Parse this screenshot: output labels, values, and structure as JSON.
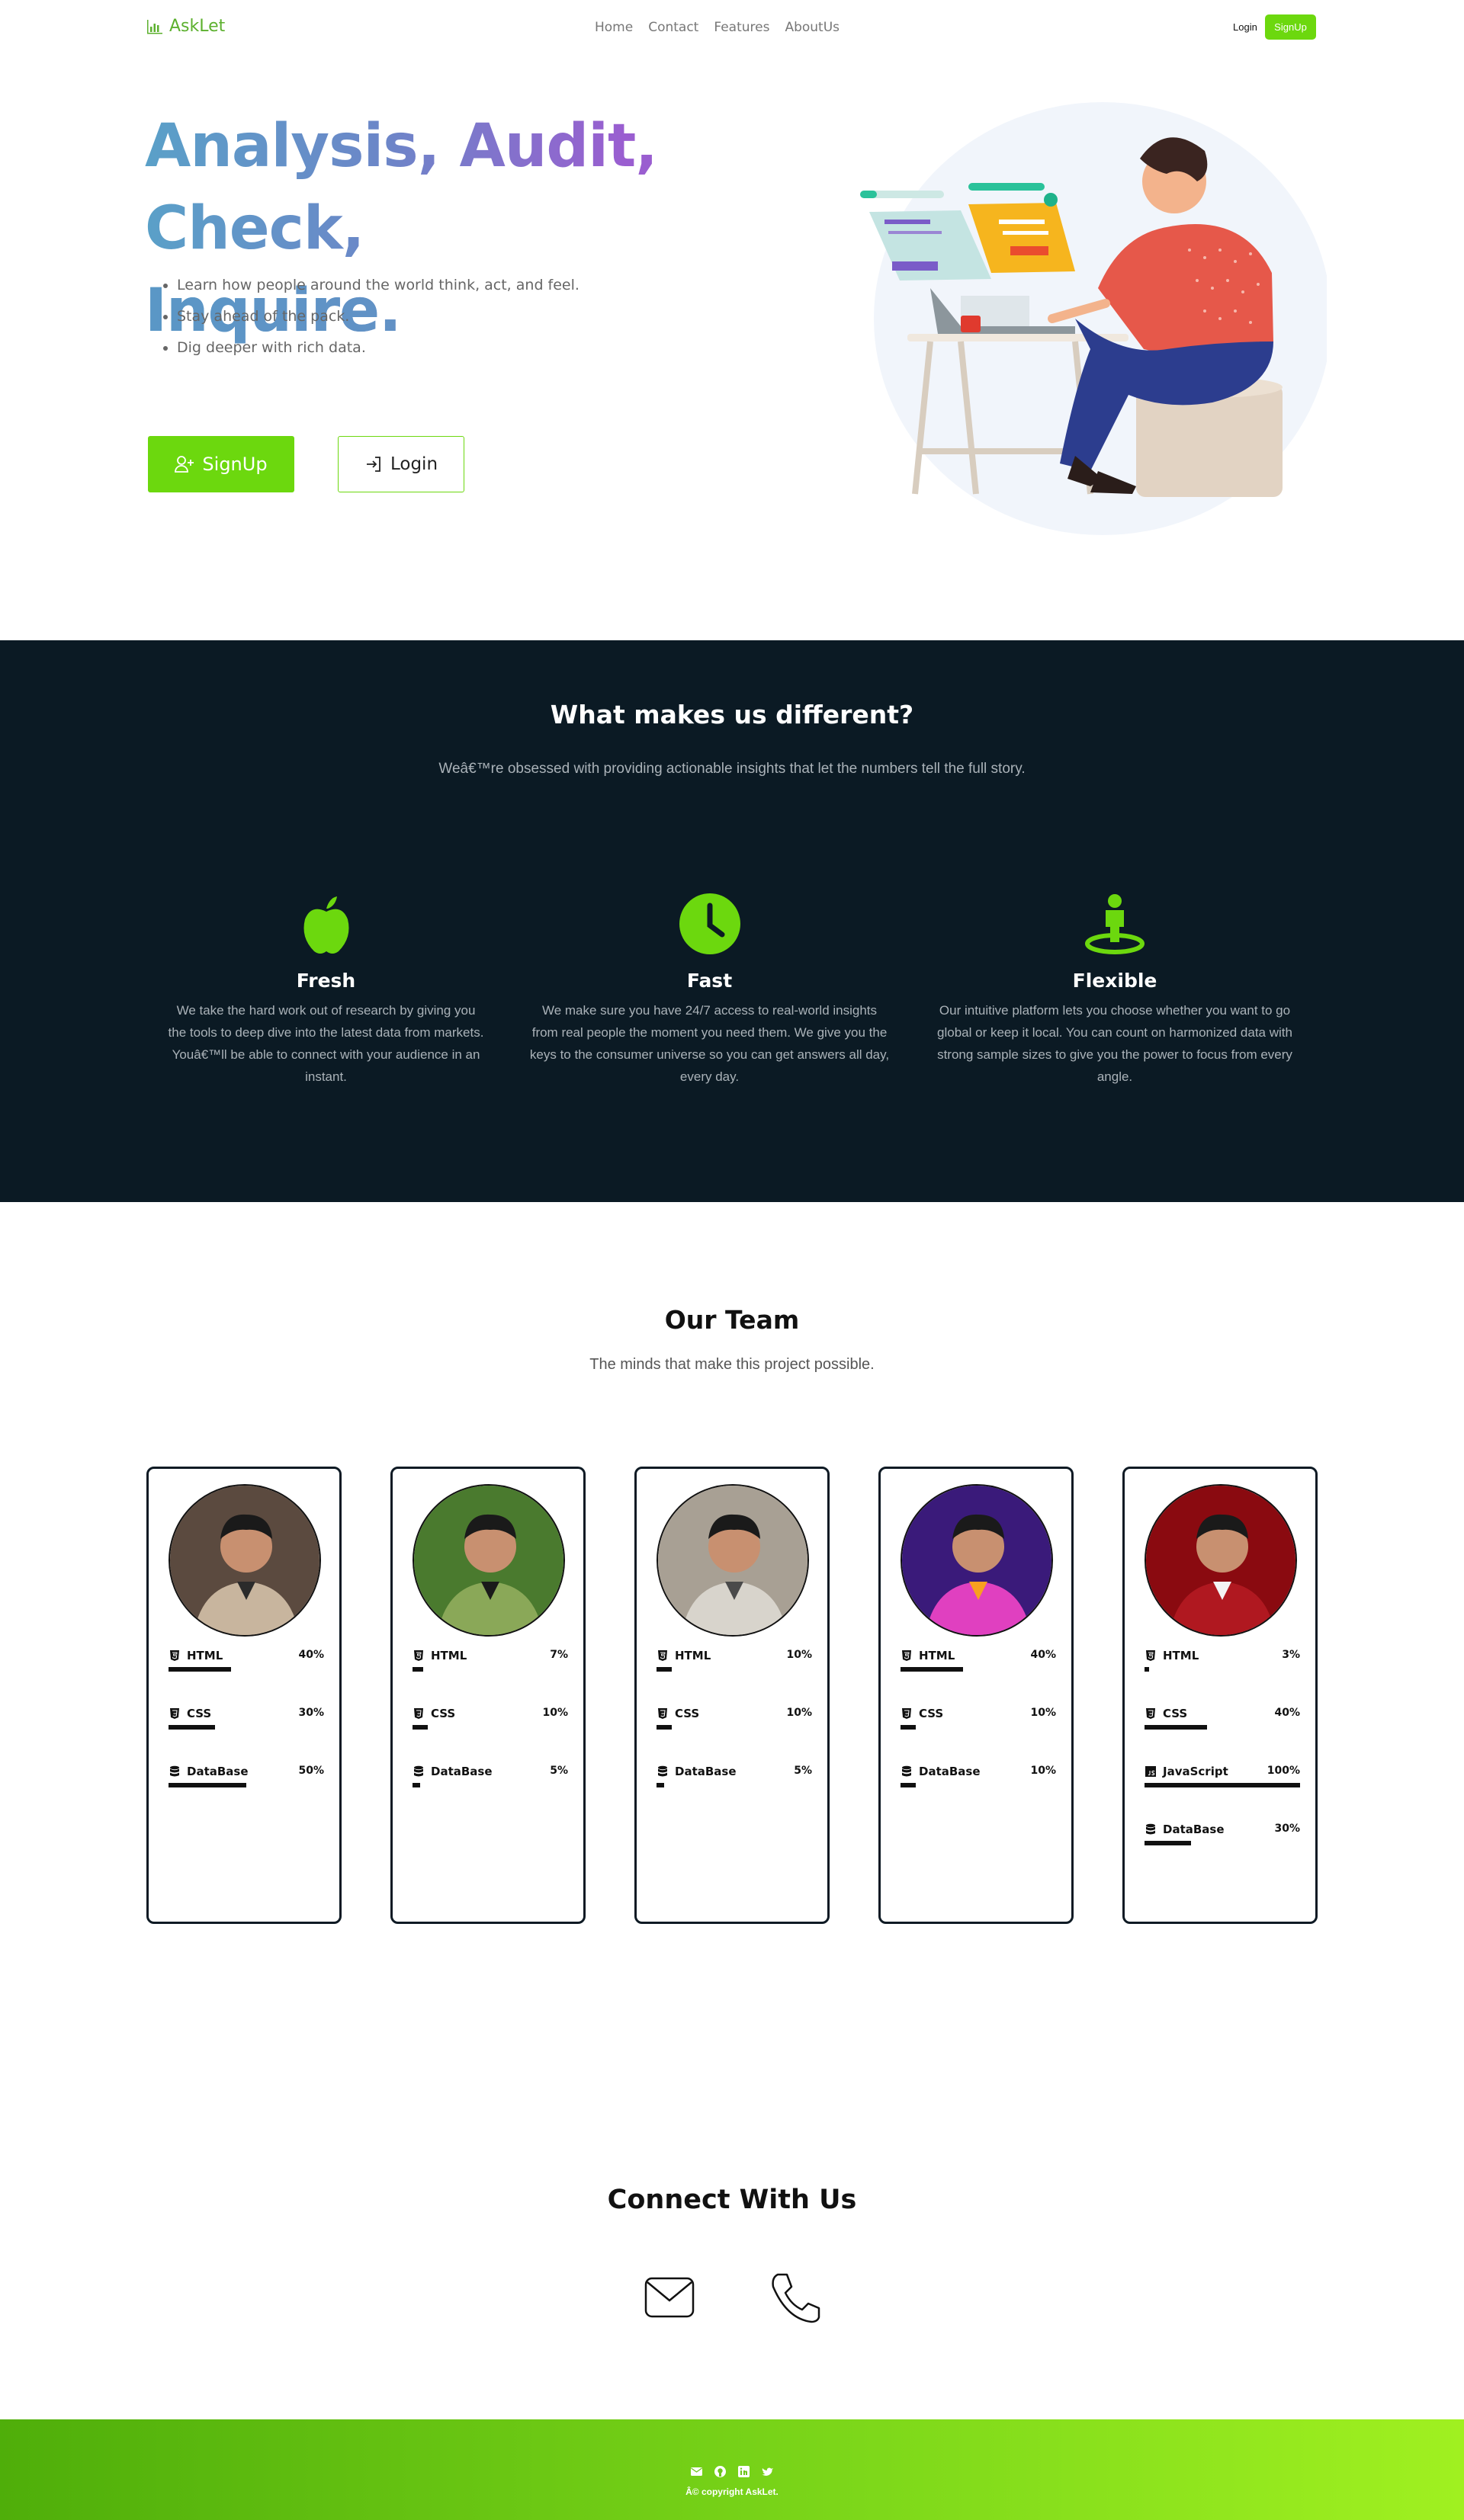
{
  "nav": {
    "brand": "AskLet",
    "links": [
      "Home",
      "Contact",
      "Features",
      "AboutUs"
    ],
    "login": "Login",
    "signup": "SignUp"
  },
  "hero": {
    "title_line1": "Analysis, Audit, Check,",
    "title_line2": "Inquire.",
    "bullets": [
      "Learn how people around the world think, act, and feel.",
      "Stay ahead of the pack.",
      "Dig deeper with rich data."
    ],
    "signup_label": "SignUp",
    "login_label": "Login"
  },
  "different": {
    "title": "What makes us different?",
    "subtitle": "Weâ€™re obsessed with providing actionable insights that let the numbers tell the full story.",
    "features": [
      {
        "icon": "apple-icon",
        "title": "Fresh",
        "text": "We take the hard work out of research by giving you the tools to deep dive into the latest data from markets. Youâ€™ll be able to connect with your audience in an instant."
      },
      {
        "icon": "clock-icon",
        "title": "Fast",
        "text": "We make sure you have 24/7 access to real-world insights from real people the moment you need them. We give you the keys to the consumer universe so you can get answers all day, every day."
      },
      {
        "icon": "person-location-icon",
        "title": "Flexible",
        "text": "Our intuitive platform lets you choose whether you want to go global or keep it local. You can count on harmonized data with strong sample sizes to give you the power to focus from every angle."
      }
    ]
  },
  "team": {
    "title": "Our Team",
    "subtitle": "The minds that make this project possible.",
    "members": [
      {
        "skills": [
          {
            "name": "HTML",
            "pct": "40%",
            "level": 40,
            "icon": "html5-icon"
          },
          {
            "name": "CSS",
            "pct": "30%",
            "level": 30,
            "icon": "css3-icon"
          },
          {
            "name": "DataBase",
            "pct": "50%",
            "level": 50,
            "icon": "database-icon"
          }
        ]
      },
      {
        "skills": [
          {
            "name": "HTML",
            "pct": "7%",
            "level": 7,
            "icon": "html5-icon"
          },
          {
            "name": "CSS",
            "pct": "10%",
            "level": 10,
            "icon": "css3-icon"
          },
          {
            "name": "DataBase",
            "pct": "5%",
            "level": 5,
            "icon": "database-icon"
          }
        ]
      },
      {
        "skills": [
          {
            "name": "HTML",
            "pct": "10%",
            "level": 10,
            "icon": "html5-icon"
          },
          {
            "name": "CSS",
            "pct": "10%",
            "level": 10,
            "icon": "css3-icon"
          },
          {
            "name": "DataBase",
            "pct": "5%",
            "level": 5,
            "icon": "database-icon"
          }
        ]
      },
      {
        "skills": [
          {
            "name": "HTML",
            "pct": "40%",
            "level": 40,
            "icon": "html5-icon"
          },
          {
            "name": "CSS",
            "pct": "10%",
            "level": 10,
            "icon": "css3-icon"
          },
          {
            "name": "DataBase",
            "pct": "10%",
            "level": 10,
            "icon": "database-icon"
          }
        ]
      },
      {
        "skills": [
          {
            "name": "HTML",
            "pct": "3%",
            "level": 3,
            "icon": "html5-icon"
          },
          {
            "name": "CSS",
            "pct": "40%",
            "level": 40,
            "icon": "css3-icon"
          },
          {
            "name": "JavaScript",
            "pct": "100%",
            "level": 100,
            "icon": "js-icon"
          },
          {
            "name": "DataBase",
            "pct": "30%",
            "level": 30,
            "icon": "database-icon"
          }
        ]
      }
    ]
  },
  "connect": {
    "title": "Connect With Us"
  },
  "footer": {
    "icons": [
      "mail-icon",
      "github-icon",
      "linkedin-icon",
      "twitter-icon"
    ],
    "copyright": "Â© copyright AskLet."
  },
  "colors": {
    "accent": "#6cd80e",
    "dark": "#0b1a24"
  }
}
